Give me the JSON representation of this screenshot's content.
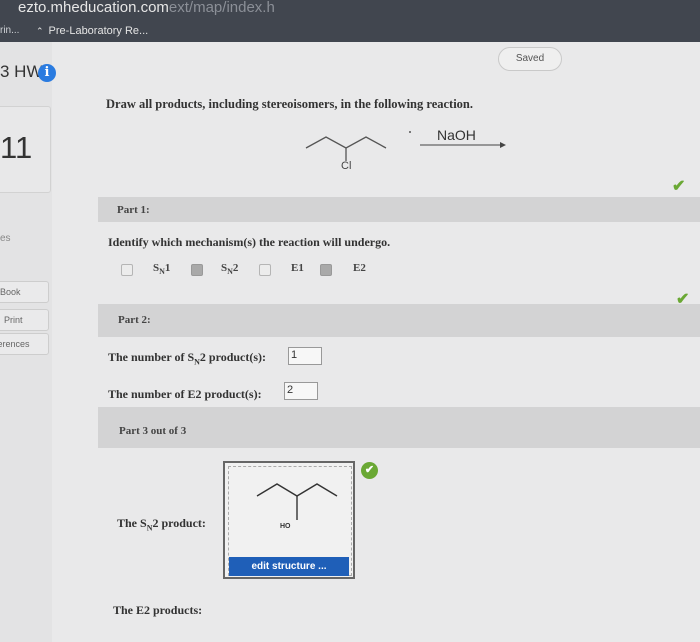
{
  "browser": {
    "url": "ezto.mheducation.com",
    "url_faint": "ext/map/index.h",
    "tab_back": "rin...",
    "tab_active": "Pre-Laboratory Re..."
  },
  "sidebar": {
    "hw_title": "3 HW",
    "question_number": "11",
    "partial_label": "es",
    "links": [
      {
        "label": "eBook"
      },
      {
        "label": "Print"
      },
      {
        "label": "ferences"
      }
    ]
  },
  "status": {
    "saved_label": "Saved"
  },
  "question": {
    "prompt": "Draw all products, including stereoisomers, in the following reaction.",
    "reagent": "NaOH",
    "substituent": "Cl"
  },
  "part1": {
    "label": "Part 1:",
    "question": "Identify which mechanism(s) the reaction will undergo.",
    "options": [
      {
        "name": "S",
        "sub": "N",
        "num": "1",
        "checked": false
      },
      {
        "name": "S",
        "sub": "N",
        "num": "2",
        "checked": true
      },
      {
        "name": "E1",
        "sub": "",
        "num": "",
        "checked": false
      },
      {
        "name": "E2",
        "sub": "",
        "num": "",
        "checked": true
      }
    ]
  },
  "part2": {
    "label": "Part 2:",
    "sn2_q_pre": "The number of S",
    "sn2_q_sub": "N",
    "sn2_q_post": "2 product(s):",
    "sn2_answer": "1",
    "e2_question": "The number of E2 product(s):",
    "e2_answer": "2"
  },
  "part3": {
    "label": "Part 3 out of 3",
    "sn2_product_pre": "The S",
    "sn2_product_sub": "N",
    "sn2_product_post": "2 product:",
    "product_substituent": "HO",
    "edit_button": "edit structure ...",
    "e2_products": "The E2 products:"
  },
  "colors": {
    "accent": "#1f5fb8",
    "success": "#6aa834",
    "info": "#2a7be0"
  }
}
